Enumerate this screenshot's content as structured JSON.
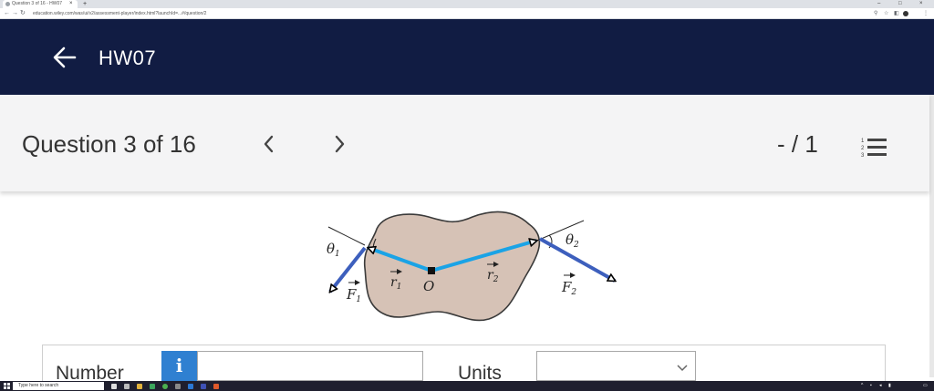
{
  "browser": {
    "tab_title": "Question 3 of 16 - HW07",
    "tab_close": "×",
    "new_tab": "+",
    "url": "education.wiley.com/was/ui/v2/assessment-player/index.html?launchId=...#/question/2",
    "window_controls": [
      "–",
      "□",
      "×"
    ]
  },
  "header": {
    "back_glyph": "←",
    "title": "HW07"
  },
  "question_nav": {
    "label": "Question 3 of 16",
    "score": "- / 1"
  },
  "figure": {
    "labels": {
      "theta1": "θ",
      "theta1_sub": "1",
      "theta2": "θ",
      "theta2_sub": "2",
      "origin": "O",
      "r1": "r",
      "r1_sub": "1",
      "r2": "r",
      "r2_sub": "2",
      "F1": "F",
      "F1_sub": "1",
      "F2": "F",
      "F2_sub": "2"
    },
    "colors": {
      "body": "#d6c2b6",
      "position_vector": "#1aa3e6",
      "force_vector": "#3d5fbd"
    }
  },
  "answer": {
    "number_label": "Number",
    "info_icon": "i",
    "number_value": "",
    "units_label": "Units",
    "units_value": ""
  },
  "taskbar": {
    "search_placeholder": "Type here to search",
    "time": "",
    "date": ""
  },
  "colors": {
    "header_bg": "#111c43",
    "info_button": "#2f80d1"
  }
}
